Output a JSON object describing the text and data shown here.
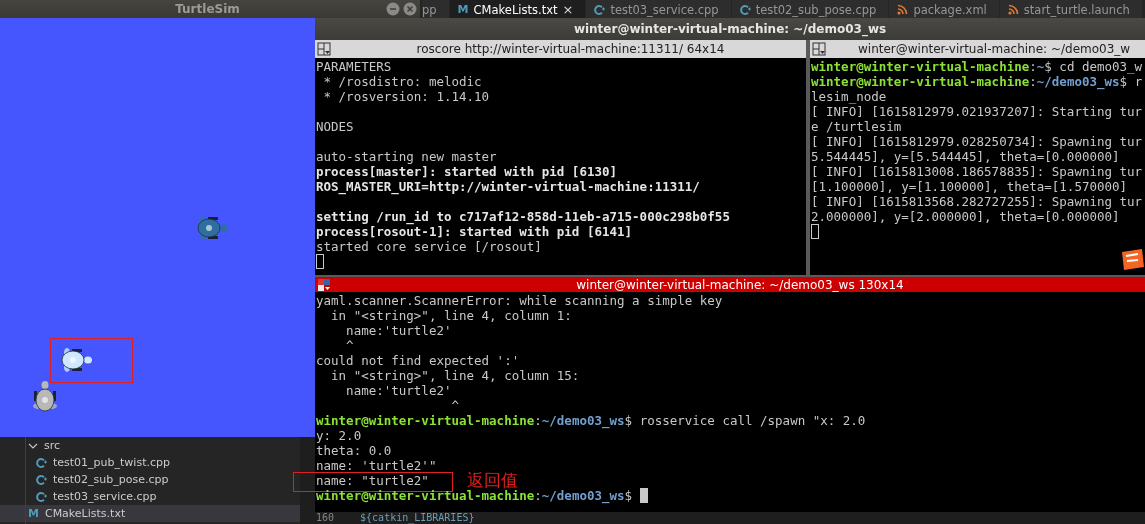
{
  "editor_tabs": [
    {
      "label": "pp",
      "kind": "none",
      "selected": false
    },
    {
      "label": "CMakeLists.txt",
      "kind": "cmake",
      "icon_text": "M",
      "selected": true,
      "close": "×"
    },
    {
      "label": "test03_service.cpp",
      "kind": "cpp",
      "selected": false
    },
    {
      "label": "test02_sub_pose.cpp",
      "kind": "cpp",
      "selected": false
    },
    {
      "label": "package.xml",
      "kind": "feed",
      "selected": false
    },
    {
      "label": "start_turtle.launch",
      "kind": "feed",
      "selected": false
    }
  ],
  "turtlesim": {
    "title": "TurtleSim",
    "turtles": [
      {
        "color": "#2f6f9f",
        "annotated": false
      },
      {
        "color": "#cfe8ff",
        "annotated": true
      },
      {
        "color": "#b8b8b8",
        "annotated": false
      }
    ]
  },
  "explorer": {
    "items": [
      {
        "label": "src",
        "kind": "folder",
        "expanded": true,
        "selected": false,
        "children": [
          {
            "label": "test01_pub_twist.cpp",
            "kind": "cpp",
            "selected": false
          },
          {
            "label": "test02_sub_pose.cpp",
            "kind": "cpp",
            "selected": false
          },
          {
            "label": "test03_service.cpp",
            "kind": "cpp",
            "selected": false
          }
        ]
      },
      {
        "label": "CMakeLists.txt",
        "kind": "cmake",
        "icon_text": "M",
        "selected": true
      }
    ]
  },
  "editor_line": {
    "number": "160",
    "text": "${catkin_LIBRARIES}"
  },
  "terminal_window": {
    "title": "winter@winter-virtual-machine: ~/demo03_ws",
    "panes": [
      {
        "title": "roscore http://winter-virtual-machine:11311/ 64x14",
        "active": false,
        "lines": [
          {
            "kind": "text",
            "segments": [
              {
                "text": "PARAMETERS",
                "kind": "plain"
              }
            ]
          },
          {
            "kind": "text",
            "segments": [
              {
                "text": " * /rosdistro: melodic",
                "kind": "plain"
              }
            ]
          },
          {
            "kind": "text",
            "segments": [
              {
                "text": " * /rosversion: 1.14.10",
                "kind": "plain"
              }
            ]
          },
          {
            "kind": "blank"
          },
          {
            "kind": "text",
            "segments": [
              {
                "text": "NODES",
                "kind": "plain"
              }
            ]
          },
          {
            "kind": "blank"
          },
          {
            "kind": "text",
            "segments": [
              {
                "text": "auto-starting new master",
                "kind": "plain"
              }
            ]
          },
          {
            "kind": "text",
            "segments": [
              {
                "text": "process[master]: started with pid [6130]",
                "kind": "bold"
              }
            ]
          },
          {
            "kind": "text",
            "segments": [
              {
                "text": "ROS_MASTER_URI=http://winter-virtual-machine:11311/",
                "kind": "bold"
              }
            ]
          },
          {
            "kind": "blank"
          },
          {
            "kind": "text",
            "segments": [
              {
                "text": "setting /run_id to c717af12-858d-11eb-a715-000c298b0f55",
                "kind": "bold"
              }
            ]
          },
          {
            "kind": "text",
            "segments": [
              {
                "text": "process[rosout-1]: started with pid [6141]",
                "kind": "bold"
              }
            ]
          },
          {
            "kind": "text",
            "segments": [
              {
                "text": "started core service [/rosout]",
                "kind": "plain"
              }
            ]
          },
          {
            "kind": "blank",
            "cursor": true
          }
        ]
      },
      {
        "title": "winter@winter-virtual-machine: ~/demo03_w",
        "active": false,
        "badge": true,
        "lines": [
          {
            "kind": "text",
            "segments": [
              {
                "text": "winter@winter-virtual-machine",
                "kind": "prompt"
              },
              {
                "text": ":",
                "kind": "plain"
              },
              {
                "text": "~",
                "kind": "path"
              },
              {
                "text": "$ cd demo03_w",
                "kind": "plain"
              }
            ]
          },
          {
            "kind": "text",
            "segments": [
              {
                "text": "winter@winter-virtual-machine",
                "kind": "prompt"
              },
              {
                "text": ":",
                "kind": "plain"
              },
              {
                "text": "~/demo03_ws",
                "kind": "path"
              },
              {
                "text": "$ r",
                "kind": "plain"
              }
            ]
          },
          {
            "kind": "text",
            "segments": [
              {
                "text": "lesim_node",
                "kind": "plain"
              }
            ]
          },
          {
            "kind": "text",
            "segments": [
              {
                "text": "[ INFO] [1615812979.021937207]: Starting tur",
                "kind": "plain"
              }
            ]
          },
          {
            "kind": "text",
            "segments": [
              {
                "text": "e /turtlesim",
                "kind": "plain"
              }
            ]
          },
          {
            "kind": "text",
            "segments": [
              {
                "text": "[ INFO] [1615812979.028250734]: Spawning tur",
                "kind": "plain"
              }
            ]
          },
          {
            "kind": "text",
            "segments": [
              {
                "text": "5.544445], y=[5.544445], theta=[0.000000]",
                "kind": "plain"
              }
            ]
          },
          {
            "kind": "text",
            "segments": [
              {
                "text": "[ INFO] [1615813008.186578835]: Spawning tur",
                "kind": "plain"
              }
            ]
          },
          {
            "kind": "text",
            "segments": [
              {
                "text": "[1.100000], y=[1.100000], theta=[1.570000]",
                "kind": "plain"
              }
            ]
          },
          {
            "kind": "text",
            "segments": [
              {
                "text": "[ INFO] [1615813568.282727255]: Spawning tur",
                "kind": "plain"
              }
            ]
          },
          {
            "kind": "text",
            "segments": [
              {
                "text": "2.000000], y=[2.000000], theta=[0.000000]",
                "kind": "plain"
              }
            ]
          },
          {
            "kind": "blank",
            "cursor": true
          }
        ]
      },
      {
        "title": "winter@winter-virtual-machine: ~/demo03_ws 130x14",
        "active": true,
        "lines": [
          {
            "kind": "text",
            "segments": [
              {
                "text": "yaml.scanner.ScannerError: while scanning a simple key",
                "kind": "plain"
              }
            ]
          },
          {
            "kind": "text",
            "segments": [
              {
                "text": "  in \"<string>\", line 4, column 1:",
                "kind": "plain"
              }
            ]
          },
          {
            "kind": "text",
            "segments": [
              {
                "text": "    name:'turtle2'",
                "kind": "plain"
              }
            ]
          },
          {
            "kind": "text",
            "segments": [
              {
                "text": "    ^",
                "kind": "plain"
              }
            ]
          },
          {
            "kind": "text",
            "segments": [
              {
                "text": "could not find expected ':'",
                "kind": "plain"
              }
            ]
          },
          {
            "kind": "text",
            "segments": [
              {
                "text": "  in \"<string>\", line 4, column 15:",
                "kind": "plain"
              }
            ]
          },
          {
            "kind": "text",
            "segments": [
              {
                "text": "    name:'turtle2'",
                "kind": "plain"
              }
            ]
          },
          {
            "kind": "text",
            "segments": [
              {
                "text": "                  ^",
                "kind": "plain"
              }
            ]
          },
          {
            "kind": "text",
            "segments": [
              {
                "text": "winter@winter-virtual-machine",
                "kind": "prompt"
              },
              {
                "text": ":",
                "kind": "plain"
              },
              {
                "text": "~/demo03_ws",
                "kind": "path"
              },
              {
                "text": "$ rosservice call /spawn \"x: 2.0",
                "kind": "plain"
              }
            ]
          },
          {
            "kind": "text",
            "segments": [
              {
                "text": "y: 2.0",
                "kind": "plain"
              }
            ]
          },
          {
            "kind": "text",
            "segments": [
              {
                "text": "theta: 0.0",
                "kind": "plain"
              }
            ]
          },
          {
            "kind": "text",
            "segments": [
              {
                "text": "name: 'turtle2'\"",
                "kind": "plain"
              }
            ]
          },
          {
            "kind": "text",
            "annotated": true,
            "note": "返回值",
            "segments": [
              {
                "text": "name: \"turtle2\"",
                "kind": "plain"
              }
            ]
          },
          {
            "kind": "text",
            "cursor": true,
            "segments": [
              {
                "text": "winter@winter-virtual-machine",
                "kind": "prompt"
              },
              {
                "text": ":",
                "kind": "plain"
              },
              {
                "text": "~/demo03_ws",
                "kind": "path"
              },
              {
                "text": "$ ",
                "kind": "plain"
              }
            ]
          }
        ]
      }
    ]
  }
}
